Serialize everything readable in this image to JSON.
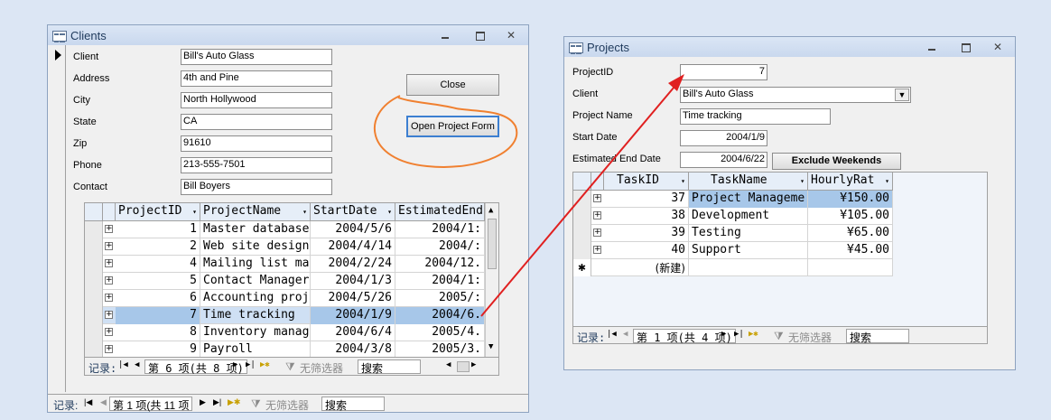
{
  "clients_form": {
    "title": "Clients",
    "fields": [
      {
        "label": "Client",
        "value": "Bill's Auto Glass"
      },
      {
        "label": "Address",
        "value": "4th and Pine"
      },
      {
        "label": "City",
        "value": "North Hollywood"
      },
      {
        "label": "State",
        "value": "CA"
      },
      {
        "label": "Zip",
        "value": "91610"
      },
      {
        "label": "Phone",
        "value": "213-555-7501"
      },
      {
        "label": "Contact",
        "value": "Bill Boyers"
      }
    ],
    "close_label": "Close",
    "open_project_label": "Open Project Form",
    "subgrid": {
      "headers": [
        "ProjectID",
        "ProjectName",
        "StartDate",
        "EstimatedEnd"
      ],
      "rows": [
        {
          "id": "1",
          "name": "Master database",
          "start": "2004/5/6",
          "end": "2004/1:"
        },
        {
          "id": "2",
          "name": "Web site design",
          "start": "2004/4/14",
          "end": "2004/:"
        },
        {
          "id": "4",
          "name": "Mailing list ma",
          "start": "2004/2/24",
          "end": "2004/12."
        },
        {
          "id": "5",
          "name": "Contact Manager",
          "start": "2004/1/3",
          "end": "2004/1:"
        },
        {
          "id": "6",
          "name": "Accounting proj",
          "start": "2004/5/26",
          "end": "2005/:"
        },
        {
          "id": "7",
          "name": "Time tracking",
          "start": "2004/1/9",
          "end": "2004/6."
        },
        {
          "id": "8",
          "name": "Inventory manag",
          "start": "2004/6/4",
          "end": "2005/4."
        },
        {
          "id": "9",
          "name": "Payroll",
          "start": "2004/3/8",
          "end": "2005/3."
        }
      ],
      "nav": {
        "label": "记录:",
        "position": "第 6 项(共 8 项)",
        "filter": "无筛选器",
        "search": "搜索"
      }
    },
    "nav": {
      "label": "记录:",
      "position": "第 1 项(共 11 项",
      "filter": "无筛选器",
      "search": "搜索"
    }
  },
  "projects_form": {
    "title": "Projects",
    "fields": {
      "project_id_label": "ProjectID",
      "project_id": "7",
      "client_label": "Client",
      "client": "Bill's Auto Glass",
      "project_name_label": "Project Name",
      "project_name": "Time tracking",
      "start_date_label": "Start Date",
      "start_date": "2004/1/9",
      "end_date_label": "Estimated End Date",
      "end_date": "2004/6/22"
    },
    "exclude_label": "Exclude Weekends",
    "subgrid": {
      "headers": [
        "TaskID",
        "TaskName",
        "HourlyRat"
      ],
      "rows": [
        {
          "id": "37",
          "name": "Project Manageme",
          "rate": "¥150.00"
        },
        {
          "id": "38",
          "name": "Development",
          "rate": "¥105.00"
        },
        {
          "id": "39",
          "name": "Testing",
          "rate": "¥65.00"
        },
        {
          "id": "40",
          "name": "Support",
          "rate": "¥45.00"
        }
      ],
      "new_row": "(新建)",
      "nav": {
        "label": "记录:",
        "position": "第 1 项(共 4 项)",
        "filter": "无筛选器",
        "search": "搜索"
      }
    }
  },
  "colors": {
    "selection": "#a7c7e9",
    "annotation": "#f08030",
    "arrow": "#e02020"
  }
}
